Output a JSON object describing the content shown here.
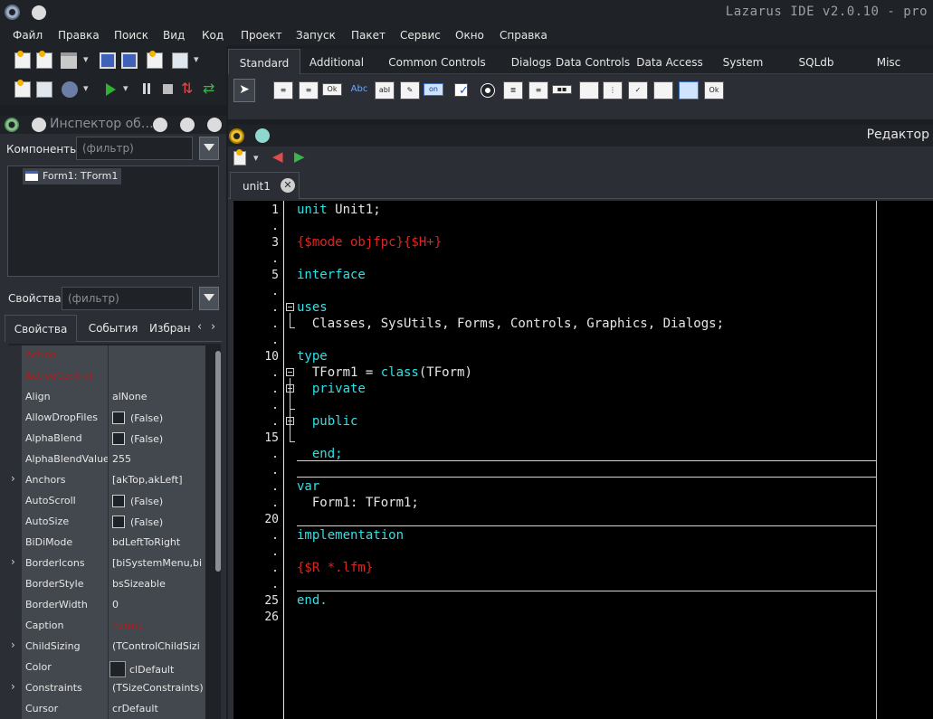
{
  "window": {
    "title": "Lazarus IDE v2.0.10 - pro"
  },
  "menu": [
    "Файл",
    "Правка",
    "Поиск",
    "Вид",
    "Код",
    "Проект",
    "Запуск",
    "Пакет",
    "Сервис",
    "Окно",
    "Справка"
  ],
  "palette": {
    "tabs": [
      "Standard",
      "Additional",
      "Common Controls",
      "Dialogs",
      "Data Controls",
      "Data Access",
      "System",
      "SQLdb",
      "Misc"
    ],
    "active_tab": "Standard",
    "icon_labels": {
      "button": "Ok",
      "label": "Abc",
      "edit": "abI",
      "toggle": "on",
      "bitbtn": "Ok"
    }
  },
  "inspector": {
    "title": "Инспектор об…",
    "components_label": "Компоненты",
    "components_filter_placeholder": "(фильтр)",
    "tree_item": "Form1: TForm1",
    "properties_label": "Свойства",
    "properties_filter_placeholder": "(фильтр)",
    "tabs": [
      "Свойства",
      "События",
      "Избран"
    ],
    "properties": [
      {
        "name": "Action",
        "value": "",
        "red_name": true
      },
      {
        "name": "ActiveControl",
        "value": "",
        "red_name": true
      },
      {
        "name": "Align",
        "value": "alNone"
      },
      {
        "name": "AllowDropFiles",
        "value": "(False)",
        "checkbox": true
      },
      {
        "name": "AlphaBlend",
        "value": "(False)",
        "checkbox": true
      },
      {
        "name": "AlphaBlendValue",
        "value": "255"
      },
      {
        "name": "Anchors",
        "value": "[akTop,akLeft]",
        "expandable": true
      },
      {
        "name": "AutoScroll",
        "value": "(False)",
        "checkbox": true
      },
      {
        "name": "AutoSize",
        "value": "(False)",
        "checkbox": true
      },
      {
        "name": "BiDiMode",
        "value": "bdLeftToRight"
      },
      {
        "name": "BorderIcons",
        "value": "[biSystemMenu,bi",
        "expandable": true
      },
      {
        "name": "BorderStyle",
        "value": "bsSizeable"
      },
      {
        "name": "BorderWidth",
        "value": "0"
      },
      {
        "name": "Caption",
        "value": "Form1",
        "red_value": true
      },
      {
        "name": "ChildSizing",
        "value": "(TControlChildSizi",
        "expandable": true
      },
      {
        "name": "Color",
        "value": "clDefault",
        "swatch": true
      },
      {
        "name": "Constraints",
        "value": "(TSizeConstraints)",
        "expandable": true
      },
      {
        "name": "Cursor",
        "value": "crDefault"
      }
    ]
  },
  "editor": {
    "title": "Редактор",
    "tab": "unit1",
    "line_numbers": [
      "1",
      ".",
      "3",
      ".",
      "5",
      ".",
      ".",
      ".",
      ".",
      "10",
      ".",
      ".",
      ".",
      ".",
      "15",
      ".",
      ".",
      ".",
      ".",
      "20",
      ".",
      ".",
      ".",
      ".",
      "25",
      "26"
    ],
    "code": {
      "l1_kw": "unit",
      "l1_rest": " Unit1;",
      "l3": "{$mode objfpc}{$H+}",
      "l5": "interface",
      "l7": "uses",
      "l8": "  Classes, SysUtils, Forms, Controls, Graphics, Dialogs;",
      "l10": "type",
      "l11_a": "  TForm1 = ",
      "l11_kw": "class",
      "l11_b": "(TForm)",
      "l12": "  private",
      "l14": "  public",
      "l16": "  end;",
      "l18": "var",
      "l19": "  Form1: TForm1;",
      "l21": "implementation",
      "l23": "{$R *.lfm}",
      "l25": "end."
    }
  }
}
